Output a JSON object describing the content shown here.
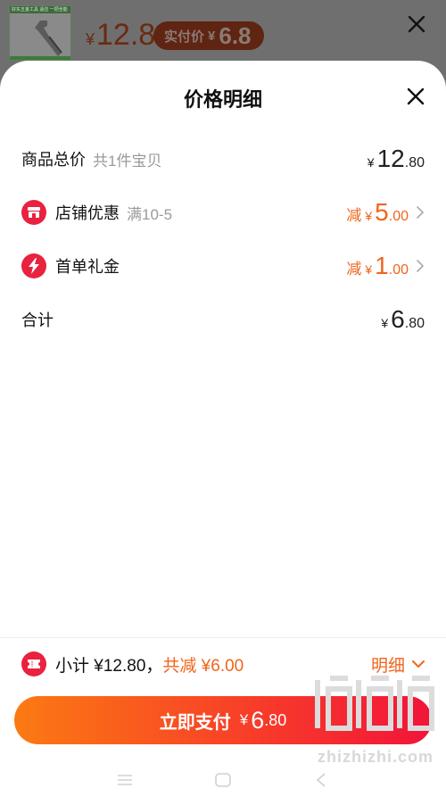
{
  "background": {
    "thumb_banner": "好东五金工具 适应 一把全能",
    "price_yen": "¥",
    "price_value": "12.8",
    "pay_label": "实付价",
    "pay_yen": "¥",
    "pay_value": "6.8"
  },
  "sheet": {
    "title": "价格明细",
    "rows": {
      "total": {
        "label": "商品总价",
        "sub": "共1件宝贝",
        "yen": "¥",
        "int": "12",
        "dec": ".80"
      },
      "shop": {
        "label": "店铺优惠",
        "sub": "满10-5",
        "prefix": "减",
        "yen": "¥",
        "int": "5",
        "dec": ".00",
        "icon": "shop-icon"
      },
      "firstorder": {
        "label": "首单礼金",
        "prefix": "减",
        "yen": "¥",
        "int": "1",
        "dec": ".00",
        "icon": "lightning-icon"
      },
      "sum": {
        "label": "合计",
        "yen": "¥",
        "int": "6",
        "dec": ".80"
      }
    }
  },
  "summary": {
    "subtotal_text": "小计 ¥12.80，",
    "saved_text": "共减 ¥6.00",
    "detail_label": "明细",
    "icon": "ticket-icon"
  },
  "pay_button": {
    "label": "立即支付",
    "yen": "¥",
    "int": "6",
    "dec": ".80"
  },
  "watermark": {
    "text": "zhizhizhi.com"
  },
  "colors": {
    "accent_orange": "#f0651b",
    "badge_red": "#e8223f",
    "button_gradient_start": "#fb7a12",
    "button_gradient_end": "#f2143a"
  }
}
